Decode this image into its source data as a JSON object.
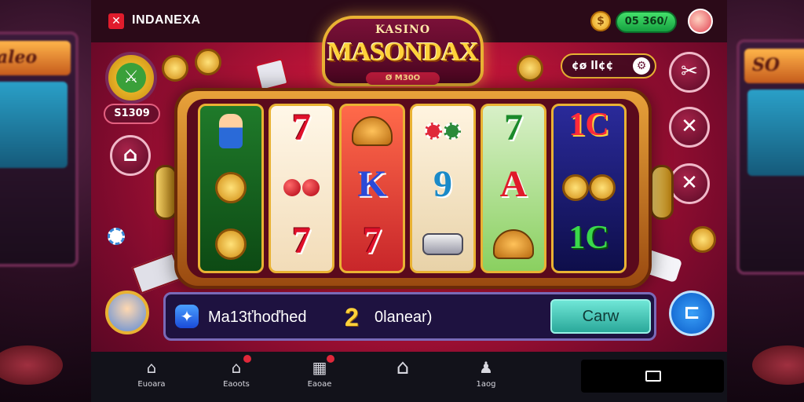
{
  "header": {
    "brand_mark": "✕",
    "brand_name": "INDANEXA",
    "currency_icon": "coin-icon",
    "coin_symbol": "$",
    "balance": "05 360/"
  },
  "title": {
    "small": "KASINO",
    "main": "MASONDAX",
    "ribbon": "Ø M30O"
  },
  "info_pill": {
    "text": "¢ø ll¢¢",
    "icon": "gear-icon"
  },
  "left_panel": {
    "score": "S1309"
  },
  "right_buttons": [
    {
      "name": "tools-button",
      "glyph": "✂"
    },
    {
      "name": "close-button",
      "glyph": "✕"
    },
    {
      "name": "cancel-button",
      "glyph": "✕"
    }
  ],
  "reels": [
    {
      "symbols": [
        "mascot",
        "coin",
        "coin"
      ]
    },
    {
      "symbols": [
        "7",
        "",
        "7"
      ]
    },
    {
      "symbols": [
        "helmet",
        "K",
        "7"
      ]
    },
    {
      "symbols": [
        "chips",
        "9",
        "stack"
      ]
    },
    {
      "symbols": [
        "7",
        "A",
        "helmet"
      ]
    },
    {
      "symbols": [
        "1C",
        "coins",
        "1C"
      ]
    }
  ],
  "action_bar": {
    "matched_text": "Ma13ťhoďhed",
    "count": "2",
    "count_label": "0lanear)",
    "claim_label": "Carw"
  },
  "menu_button": "⊏",
  "nav": [
    {
      "label": "Euoara",
      "icon": "home-icon",
      "badge": false
    },
    {
      "label": "Eaoots",
      "icon": "shop-icon",
      "badge": true
    },
    {
      "label": "Eaoae",
      "icon": "grid-icon",
      "badge": true
    },
    {
      "label": "",
      "icon": "home-outline-icon",
      "badge": false
    },
    {
      "label": "1aog",
      "icon": "bag-icon",
      "badge": false
    }
  ],
  "colors": {
    "accent_gold": "#e9b233",
    "frame_red": "#c8163a",
    "claim_teal": "#2aa89a",
    "balance_green": "#15a040"
  }
}
